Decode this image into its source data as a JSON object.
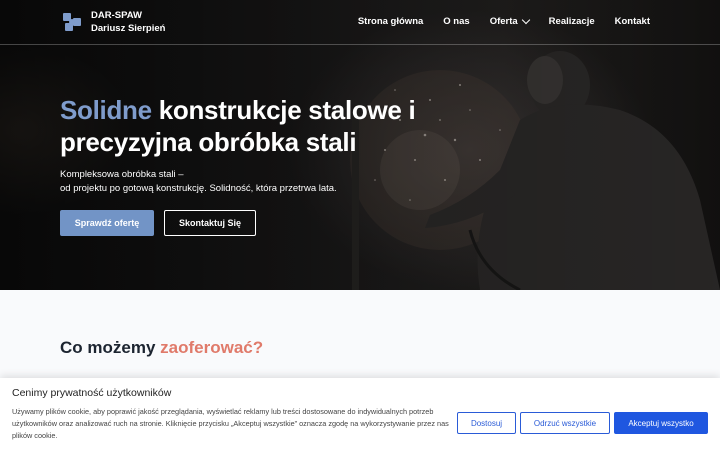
{
  "brand": {
    "name": "DAR-SPAW",
    "owner": "Dariusz Sierpień"
  },
  "nav": {
    "home": "Strona główna",
    "about": "O nas",
    "offer": "Oferta",
    "projects": "Realizacje",
    "contact": "Kontakt"
  },
  "hero": {
    "title_accent": "Solidne",
    "title_rest": " konstrukcje stalowe i precyzyjna obróbka stali",
    "subtitle_line1": "Kompleksowa obróbka stali –",
    "subtitle_line2": "od projektu po gotową konstrukcję. Solidność, która przetrwa lata.",
    "primary_button": "Sprawdź ofertę",
    "secondary_button": "Skontaktuj Się"
  },
  "section": {
    "title_start": "Co możemy ",
    "title_accent": "zaoferować?"
  },
  "cookie": {
    "title": "Cenimy prywatność użytkowników",
    "text": "Używamy plików cookie, aby poprawić jakość przeglądania, wyświetlać reklamy lub treści dostosowane do indywidualnych potrzeb użytkowników oraz analizować ruch na stronie. Kliknięcie przycisku „Akceptuj wszystkie” oznacza zgodę na wykorzystywanie przez nas plików cookie.",
    "customize": "Dostosuj",
    "reject": "Odrzuć wszystkie",
    "accept": "Akceptuj wszystko"
  },
  "colors": {
    "accent_blue": "#7f9ccc",
    "accent_coral": "#e07a6a",
    "cookie_blue": "#1f57e0"
  },
  "icons": {
    "logo": "gear-puzzle-icon",
    "dropdown": "chevron-down-icon"
  }
}
